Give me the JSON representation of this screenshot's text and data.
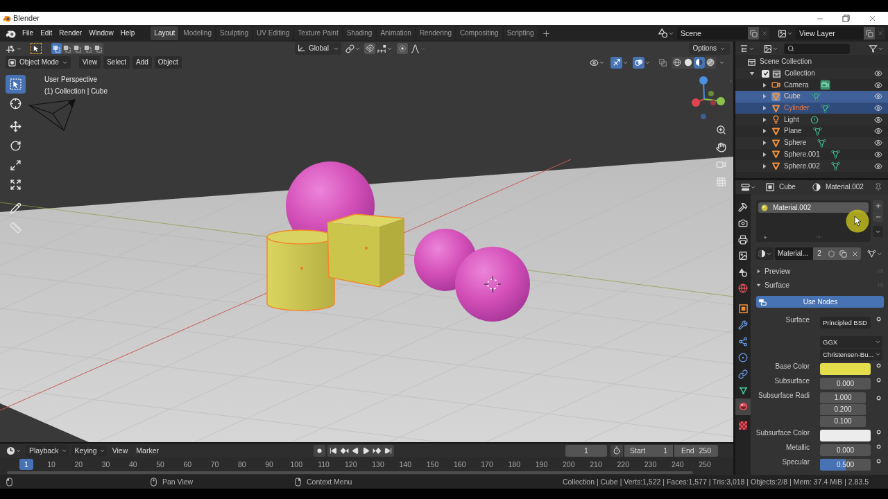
{
  "title_bar": {
    "title": "Blender"
  },
  "menu_bar": {
    "menus": [
      "File",
      "Edit",
      "Render",
      "Window",
      "Help"
    ],
    "workspaces": [
      {
        "label": "Layout",
        "selected": true
      },
      {
        "label": "Modeling",
        "selected": false
      },
      {
        "label": "Sculpting",
        "selected": false
      },
      {
        "label": "UV Editing",
        "selected": false
      },
      {
        "label": "Texture Paint",
        "selected": false
      },
      {
        "label": "Shading",
        "selected": false
      },
      {
        "label": "Animation",
        "selected": false
      },
      {
        "label": "Rendering",
        "selected": false
      },
      {
        "label": "Compositing",
        "selected": false
      },
      {
        "label": "Scripting",
        "selected": false
      }
    ],
    "scene": "Scene",
    "view_layer": "View Layer"
  },
  "tool_header": {
    "select_modes": [
      {
        "selected": true
      },
      {
        "selected": false
      },
      {
        "selected": false
      },
      {
        "selected": false
      },
      {
        "selected": false
      }
    ],
    "orientation": "Global",
    "options": "Options"
  },
  "viewport_header": {
    "mode": "Object Mode",
    "menus": [
      "View",
      "Select",
      "Add",
      "Object"
    ],
    "gizmos": true,
    "overlays": true,
    "shading": [
      {
        "kind": "wireframe",
        "selected": false
      },
      {
        "kind": "solid",
        "selected": false
      },
      {
        "kind": "material",
        "selected": true
      },
      {
        "kind": "rendered",
        "selected": false
      }
    ]
  },
  "viewport": {
    "perspective": "User Perspective",
    "context": "(1) Collection | Cube",
    "tools": [
      {
        "kind": "select_box",
        "selected": true
      },
      {
        "kind": "cursor",
        "selected": false
      },
      {
        "kind": "move",
        "selected": false
      },
      {
        "kind": "rotate",
        "selected": false
      },
      {
        "kind": "scale",
        "selected": false
      },
      {
        "kind": "transform",
        "selected": false
      },
      {
        "kind": "annotate",
        "selected": false
      },
      {
        "kind": "measure",
        "selected": false
      }
    ]
  },
  "outliner": {
    "root": "Scene Collection",
    "children": [
      {
        "label": "Collection",
        "kind": "collection",
        "checked": true,
        "expanded": true,
        "visible": true,
        "children": [
          {
            "label": "Camera",
            "kind": "camera",
            "expanded": false,
            "selected": false,
            "active": false,
            "visible": true
          },
          {
            "label": "Cube",
            "kind": "mesh",
            "expanded": false,
            "selected": true,
            "active": true,
            "visible": true
          },
          {
            "label": "Cylinder",
            "kind": "mesh",
            "expanded": false,
            "selected": true,
            "active": false,
            "visible": true
          },
          {
            "label": "Light",
            "kind": "light",
            "expanded": false,
            "selected": false,
            "active": false,
            "visible": true
          },
          {
            "label": "Plane",
            "kind": "mesh",
            "expanded": false,
            "selected": false,
            "active": false,
            "visible": true
          },
          {
            "label": "Sphere",
            "kind": "mesh",
            "expanded": false,
            "selected": false,
            "active": false,
            "visible": true
          },
          {
            "label": "Sphere.001",
            "kind": "mesh",
            "expanded": false,
            "selected": false,
            "active": false,
            "visible": true
          },
          {
            "label": "Sphere.002",
            "kind": "mesh",
            "expanded": false,
            "selected": false,
            "active": false,
            "visible": true
          }
        ]
      }
    ]
  },
  "properties": {
    "object": "Cube",
    "material": "Material.002",
    "tabs": [
      {
        "kind": "tool",
        "selected": false
      },
      {
        "kind": "render",
        "selected": false
      },
      {
        "kind": "output",
        "selected": false
      },
      {
        "kind": "view_layer",
        "selected": false
      },
      {
        "kind": "scene",
        "selected": false
      },
      {
        "kind": "world",
        "selected": false
      },
      {
        "kind": "object",
        "selected": false
      },
      {
        "kind": "modifiers",
        "selected": false
      },
      {
        "kind": "particles",
        "selected": false
      },
      {
        "kind": "physics",
        "selected": false
      },
      {
        "kind": "constraints",
        "selected": false
      },
      {
        "kind": "data",
        "selected": false
      },
      {
        "kind": "material",
        "selected": true
      },
      {
        "kind": "texture",
        "selected": false
      }
    ],
    "slots": [
      {
        "label": "Material.002",
        "selected": true
      }
    ],
    "datablock": {
      "name": "Material...",
      "users": "2"
    },
    "panels": [
      {
        "label": "Preview",
        "expanded": false
      },
      {
        "label": "Surface",
        "expanded": true,
        "use_nodes": "Use Nodes",
        "fields": [
          {
            "kind": "link",
            "label": "Surface",
            "value": "Principled BSD"
          },
          {
            "kind": "dropdown",
            "value": "GGX"
          },
          {
            "kind": "dropdown",
            "value": "Christensen-Bu..."
          },
          {
            "kind": "color",
            "label": "Base Color",
            "color": "#e5de4c"
          },
          {
            "kind": "number",
            "label": "Subsurface",
            "value": "0.000"
          },
          {
            "kind": "vector",
            "label": "Subsurface Radi",
            "values": [
              "1.000",
              "0.200",
              "0.100"
            ]
          },
          {
            "kind": "color",
            "label": "Subsurface Color",
            "color": "#ececec"
          },
          {
            "kind": "number",
            "label": "Metallic",
            "value": "0.000"
          },
          {
            "kind": "slider",
            "label": "Specular",
            "value": "0.500",
            "level": 0.5
          }
        ]
      }
    ]
  },
  "timeline": {
    "menus": [
      {
        "label": "Playback",
        "kind": "dropdown"
      },
      {
        "label": "Keying",
        "kind": "dropdown"
      },
      {
        "label": "View",
        "kind": "menu"
      },
      {
        "label": "Marker",
        "kind": "menu"
      }
    ],
    "current_frame": "1",
    "start_label": "Start",
    "start": "1",
    "end_label": "End",
    "end": "250",
    "playhead": "1",
    "ruler": [
      "10",
      "20",
      "30",
      "40",
      "50",
      "60",
      "70",
      "80",
      "90",
      "100",
      "110",
      "120",
      "130",
      "140",
      "150",
      "160",
      "170",
      "180",
      "190",
      "200",
      "210",
      "220",
      "230",
      "240",
      "250"
    ]
  },
  "status_bar": {
    "hints": [
      {
        "kind": "left_mouse"
      },
      {
        "kind": "middle_mouse",
        "label": "Pan View"
      },
      {
        "kind": "right_mouse",
        "label": "Context Menu"
      }
    ],
    "stats": "Collection | Cube | Verts:1,522 | Faces:1,577 | Tris:3,018 | Objects:2/8 | Mem: 37.4 MiB | 2.83.5"
  }
}
